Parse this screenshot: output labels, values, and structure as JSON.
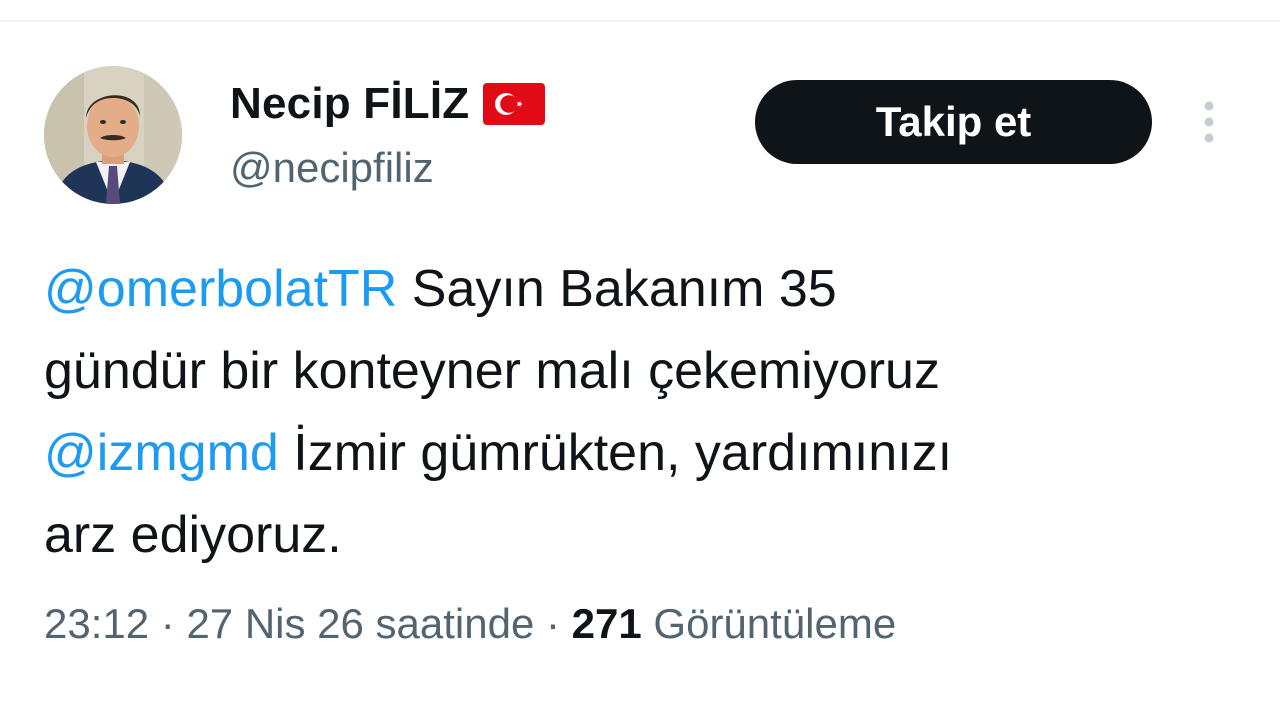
{
  "author": {
    "display_name": "Necip FİLİZ",
    "handle": "@necipfiliz",
    "flag_icon": "turkey-flag-icon"
  },
  "actions": {
    "follow_label": "Takip et",
    "more_icon": "more-vertical-icon"
  },
  "tweet": {
    "lines": [
      {
        "mention": "@omerbolatTR",
        "text": " Sayın Bakanım 35"
      },
      {
        "text": "gündür bir konteyner malı çekemiyoruz"
      },
      {
        "mention": "@izmgmd",
        "text": " İzmir gümrükten, yardımınızı"
      },
      {
        "text": "arz ediyoruz."
      }
    ]
  },
  "meta": {
    "time": "23:12",
    "separator": " · ",
    "date": "27 Nis 26 saatinde",
    "views_count": "271",
    "views_label": "Görüntüleme"
  },
  "colors": {
    "link": "#1d9bf0",
    "text": "#0f1419",
    "secondary": "#536471",
    "follow_bg": "#0f1419",
    "flag_red": "#e30a17"
  }
}
